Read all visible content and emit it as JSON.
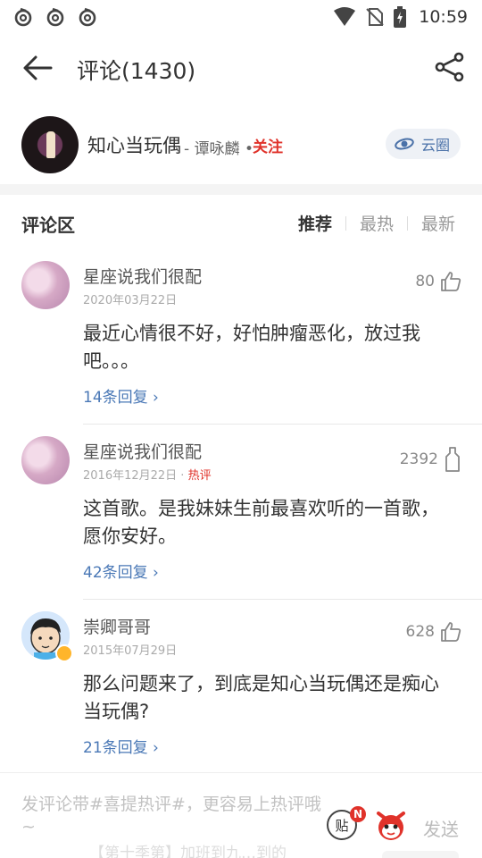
{
  "status_bar": {
    "time": "10:59"
  },
  "header": {
    "title": "评论(1430)"
  },
  "song": {
    "title": "知心当玩偶",
    "artist": "- 谭咏麟 •",
    "follow": "关注",
    "circle": "云圈"
  },
  "section": {
    "title": "评论区",
    "tabs": [
      "推荐",
      "最热",
      "最新"
    ]
  },
  "comments": [
    {
      "name": "星座说我们很配",
      "date": "2020年03月22日",
      "hot": "",
      "likes": "80",
      "text": "最近心情很不好，好怕肿瘤恶化，放过我吧。。。",
      "replies": "14条回复 ›"
    },
    {
      "name": "星座说我们很配",
      "date": "2016年12月22日 ·",
      "hot": "热评",
      "likes": "2392",
      "text": "这首歌。是我妹妹生前最喜欢听的一首歌，愿你安好。",
      "replies": "42条回复 ›"
    },
    {
      "name": "崇卿哥哥",
      "date": "2015年07月29日",
      "hot": "",
      "likes": "628",
      "text": "那么问题来了，到底是知心当玩偶还是痴心当玩偶?",
      "replies": "21条回复 ›"
    }
  ],
  "bottom": {
    "placeholder": "发评论带#喜提热评#，更容易上热评哦~",
    "tie_label": "贴",
    "tie_badge": "N",
    "send": "发送",
    "ghost_text": "【第十季第】加班到九…到的"
  },
  "colors": {
    "accent_red": "#e0322a",
    "link_blue": "#4a78b6"
  }
}
